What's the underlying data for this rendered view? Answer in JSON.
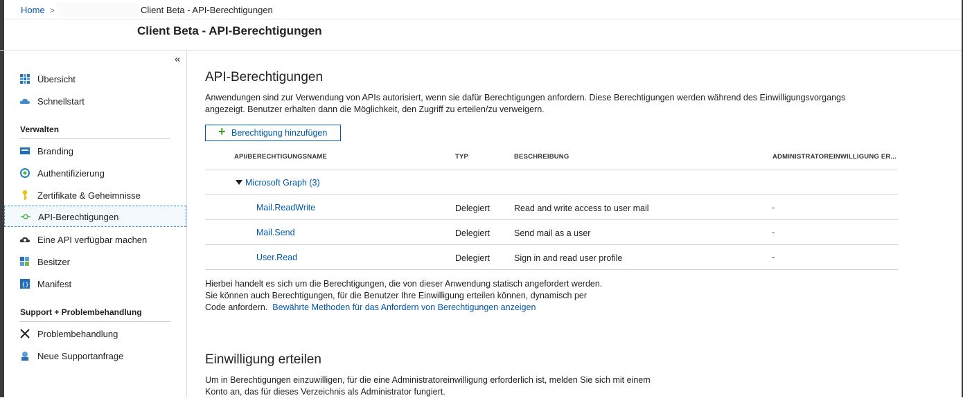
{
  "breadcrumb": {
    "home": "Home",
    "separator": ">",
    "current": "Client Beta - API-Berechtigungen"
  },
  "header": {
    "title": "Client Beta - API-Berechtigungen"
  },
  "sidebar": {
    "collapse_label": "«",
    "items_top": [
      {
        "label": "Übersicht",
        "icon": "grid-icon"
      },
      {
        "label": "Schnellstart",
        "icon": "cloud-icon"
      }
    ],
    "section_manage": "Verwalten",
    "items_manage": [
      {
        "label": "Branding",
        "icon": "branding-icon"
      },
      {
        "label": "Authentifizierung",
        "icon": "authentication-icon"
      },
      {
        "label": "Zertifikate & Geheimnisse",
        "icon": "key-icon"
      },
      {
        "label": "API-Berechtigungen",
        "icon": "api-permissions-icon",
        "active": true
      },
      {
        "label": "Eine API verfügbar machen",
        "icon": "cloud-gear-icon"
      },
      {
        "label": "Besitzer",
        "icon": "owners-icon"
      },
      {
        "label": "Manifest",
        "icon": "manifest-icon"
      }
    ],
    "section_support": "Support + Problembehandlung",
    "items_support": [
      {
        "label": "Problembehandlung",
        "icon": "tools-icon"
      },
      {
        "label": "Neue Supportanfrage",
        "icon": "support-icon"
      }
    ]
  },
  "main": {
    "title": "API-Berechtigungen",
    "intro_line1": "Anwendungen sind zur Verwendung von APIs autorisiert, wenn sie dafür Berechtigungen anfordern. Diese Berechtigungen werden während des Einwilligungsvorgangs",
    "intro_line2": "angezeigt. Benutzer erhalten dann die Möglichkeit, den Zugriff zu erteilen/zu verweigern.",
    "add_button": "Berechtigung hinzufügen",
    "table": {
      "columns": [
        "API/BERECHTIGUNGSNAME",
        "TYP",
        "BESCHREIBUNG",
        "ADMINISTRATOREINWILLIGUNG ER..."
      ],
      "group": "Microsoft Graph (3)",
      "rows": [
        {
          "name": "Mail.ReadWrite",
          "type": "Delegiert",
          "description": "Read and write access to user mail",
          "admin": "-"
        },
        {
          "name": "Mail.Send",
          "type": "Delegiert",
          "description": "Send mail as a user",
          "admin": "-"
        },
        {
          "name": "User.Read",
          "type": "Delegiert",
          "description": "Sign in and read user profile",
          "admin": "-"
        }
      ]
    },
    "note_line1": "Hierbei handelt es sich um die Berechtigungen, die von dieser Anwendung statisch angefordert werden.",
    "note_line2": "Sie können auch Berechtigungen, für die Benutzer Ihre Einwilligung erteilen können, dynamisch per",
    "note_line3": "Code anfordern.",
    "note_link": "Bewährte Methoden für das Anfordern von Berechtigungen anzeigen",
    "consent_title": "Einwilligung erteilen",
    "consent_line1": "Um in Berechtigungen einzuwilligen, für die eine Administratoreinwilligung erforderlich ist, melden Sie sich mit einem",
    "consent_line2": "Konto an, das für dieses Verzeichnis als Administrator fungiert."
  },
  "colors": {
    "link": "#0058ad",
    "active_border": "#3a8fcf",
    "plus": "#3f9a27"
  }
}
